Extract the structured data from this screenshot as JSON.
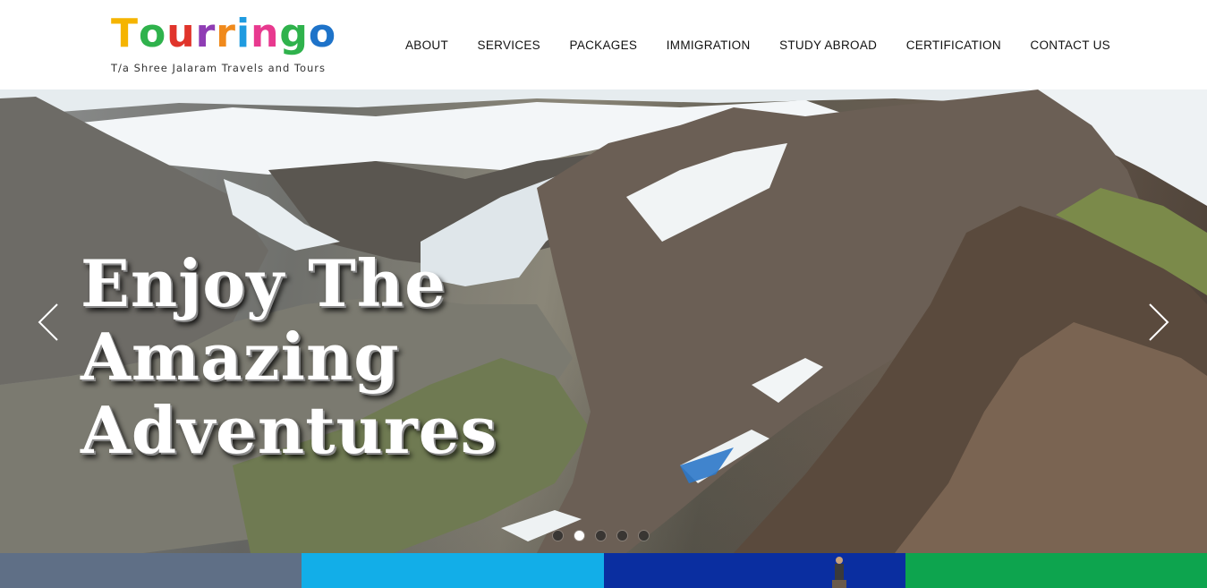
{
  "logo": {
    "letters": [
      {
        "ch": "T",
        "color": "#f5b400"
      },
      {
        "ch": "o",
        "color": "#2fb24c"
      },
      {
        "ch": "u",
        "color": "#e0342b"
      },
      {
        "ch": "r",
        "color": "#8f3db4"
      },
      {
        "ch": "r",
        "color": "#f08a1c"
      },
      {
        "ch": "i",
        "color": "#1f9be0"
      },
      {
        "ch": "n",
        "color": "#e8398f"
      },
      {
        "ch": "g",
        "color": "#2fb24c"
      },
      {
        "ch": "o",
        "color": "#1e73c9"
      }
    ],
    "tagline": "T/a Shree Jalaram Travels and Tours"
  },
  "nav": {
    "items": [
      "ABOUT",
      "SERVICES",
      "PACKAGES",
      "IMMIGRATION",
      "STUDY ABROAD",
      "CERTIFICATION",
      "CONTACT US"
    ]
  },
  "hero": {
    "title_lines": [
      "Enjoy The",
      "Amazing",
      "Adventures"
    ],
    "prev_icon": "chevron-left-icon",
    "next_icon": "chevron-right-icon",
    "slide_count": 5,
    "active_slide": 2
  },
  "tiles": {
    "colors": [
      "#5f6f86",
      "#12aee8",
      "#0a2ea0",
      "#0da44e"
    ]
  }
}
